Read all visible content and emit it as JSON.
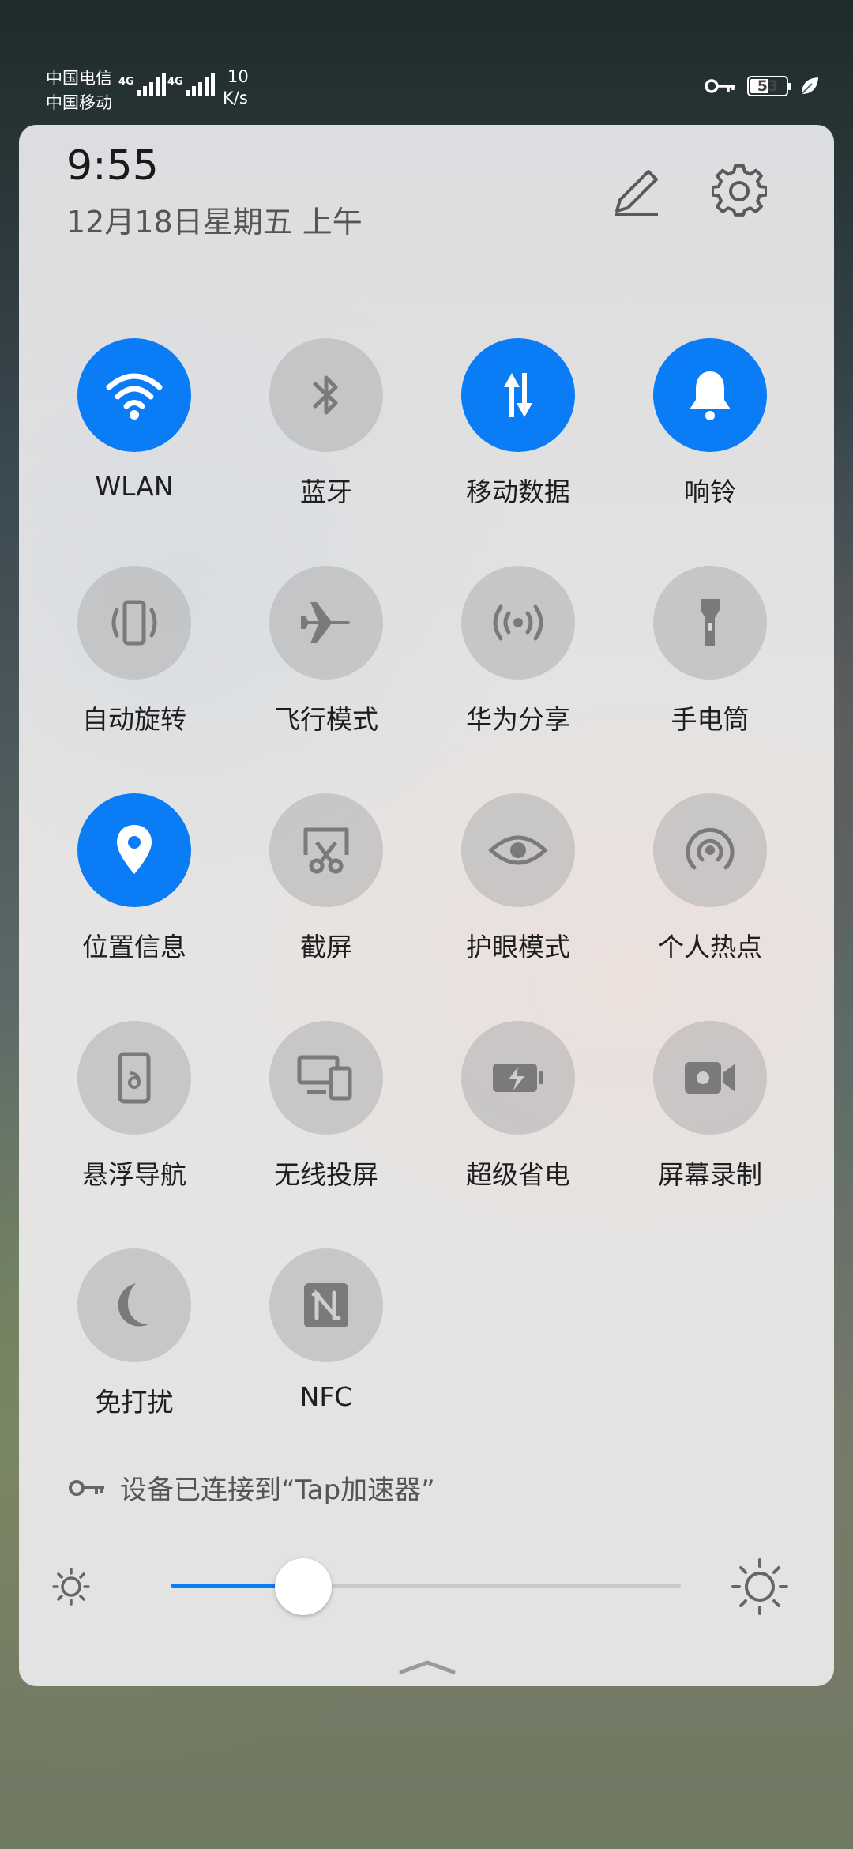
{
  "status_bar": {
    "carrier_1": "中国电信",
    "carrier_2": "中国移动",
    "network_1": "4G",
    "network_2": "4G",
    "speed_value": "10",
    "speed_unit": "K/s",
    "battery_level": "53",
    "battery_fraction": 0.53,
    "icons": [
      "vpn-key-icon",
      "battery-icon",
      "leaf-icon"
    ]
  },
  "header": {
    "time": "9:55",
    "date": "12月18日星期五 上午",
    "edit_icon": "pencil-icon",
    "settings_icon": "gear-icon"
  },
  "tiles": [
    {
      "label": "WLAN",
      "icon": "wifi-icon",
      "on": true
    },
    {
      "label": "蓝牙",
      "icon": "bluetooth-icon",
      "on": false
    },
    {
      "label": "移动数据",
      "icon": "mobile-data-icon",
      "on": true
    },
    {
      "label": "响铃",
      "icon": "bell-icon",
      "on": true
    },
    {
      "label": "自动旋转",
      "icon": "auto-rotate-icon",
      "on": false
    },
    {
      "label": "飞行模式",
      "icon": "airplane-icon",
      "on": false
    },
    {
      "label": "华为分享",
      "icon": "share-signal-icon",
      "on": false
    },
    {
      "label": "手电筒",
      "icon": "flashlight-icon",
      "on": false
    },
    {
      "label": "位置信息",
      "icon": "location-pin-icon",
      "on": true
    },
    {
      "label": "截屏",
      "icon": "screenshot-scissors-icon",
      "on": false
    },
    {
      "label": "护眼模式",
      "icon": "eye-icon",
      "on": false
    },
    {
      "label": "个人热点",
      "icon": "hotspot-icon",
      "on": false
    },
    {
      "label": "悬浮导航",
      "icon": "floating-nav-icon",
      "on": false
    },
    {
      "label": "无线投屏",
      "icon": "wireless-projection-icon",
      "on": false
    },
    {
      "label": "超级省电",
      "icon": "battery-saver-icon",
      "on": false
    },
    {
      "label": "屏幕录制",
      "icon": "screen-record-icon",
      "on": false
    },
    {
      "label": "免打扰",
      "icon": "moon-icon",
      "on": false
    },
    {
      "label": "NFC",
      "icon": "nfc-icon",
      "on": false
    }
  ],
  "vpn_notice": {
    "icon": "vpn-key-icon",
    "text": "设备已连接到“Tap加速器”"
  },
  "brightness": {
    "level": 0.26,
    "low_icon": "sun-small-icon",
    "high_icon": "sun-large-icon"
  },
  "colors": {
    "accent": "#0a7cf5",
    "tile_off": "#b4b4b4",
    "icon_off": "#7a7a7a"
  }
}
